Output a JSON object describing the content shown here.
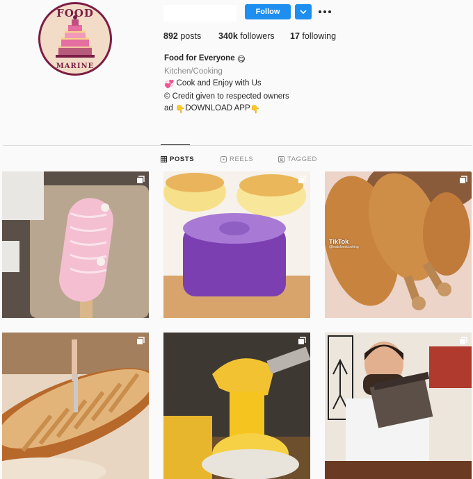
{
  "profile": {
    "avatar": {
      "top_word": "FOOD",
      "bottom_word": "MARINE",
      "colors": {
        "ring": "#7b1d45",
        "background": "#f2dcc7",
        "cake": "#e46fa0"
      }
    },
    "follow_label": "Follow",
    "accent_color": "#1e8ff0"
  },
  "stats": {
    "posts": {
      "value": "892",
      "label": "posts"
    },
    "followers": {
      "value": "340k",
      "label": "followers"
    },
    "following": {
      "value": "17",
      "label": "following"
    }
  },
  "bio": {
    "name": "Food for Everyone",
    "name_emoji": "😋",
    "category": "Kitchen/Cooking",
    "line1_emoji": "💞",
    "line1": "Cook and Enjoy with Us",
    "line2": "© Credit given to respected owners",
    "line3_prefix": "ad",
    "line3_emoji": "👇",
    "line3_text": "DOWNLOAD APP"
  },
  "tabs": [
    {
      "label": "POSTS",
      "icon": "grid-icon",
      "active": true
    },
    {
      "label": "REELS",
      "icon": "reels-icon",
      "active": false
    },
    {
      "label": "TAGGED",
      "icon": "tagged-icon",
      "active": false
    }
  ],
  "grid": {
    "tiles": [
      {
        "subject": "pink glazed popsicle cake on baking mat",
        "multi": true
      },
      {
        "subject": "purple ube chiffon cake",
        "multi": true
      },
      {
        "subject": "fried coated chicken drumsticks",
        "multi": true,
        "overlay": {
          "brand": "TikTok",
          "handle": "@ieatsfoodcooking"
        }
      },
      {
        "subject": "braided pastry with caramel sauce",
        "multi": true
      },
      {
        "subject": "pouring yellow mac and cheese",
        "multi": true
      },
      {
        "subject": "man eating slice of cheesecake",
        "multi": true
      }
    ]
  }
}
